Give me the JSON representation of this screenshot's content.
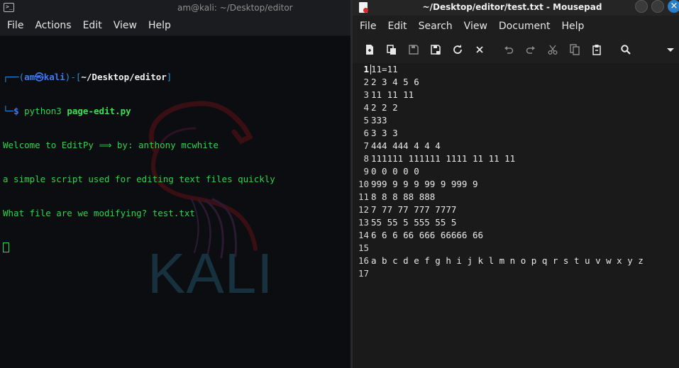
{
  "terminal": {
    "title": "am@kali: ~/Desktop/editor",
    "menu": [
      "File",
      "Actions",
      "Edit",
      "View",
      "Help"
    ],
    "prompt": {
      "open": "┌──(",
      "user": "am",
      "at": "㉿",
      "host": "kali",
      "mid": ")-[",
      "path": "~/Desktop/editor",
      "close": "]",
      "second": "└─",
      "dollar": "$ ",
      "cmd": "python3",
      "arg": " page-edit.py"
    },
    "output": [
      "Welcome to EditPy ⟹ by: anthony mcwhite",
      "a simple script used for editing text files quickly"
    ],
    "question": "What file are we modifying? ",
    "answer": "test.txt",
    "logo_text": "KALI"
  },
  "mousepad": {
    "title": "~/Desktop/editor/test.txt - Mousepad",
    "close_glyph": "×",
    "menu": [
      "File",
      "Edit",
      "Search",
      "View",
      "Document",
      "Help"
    ],
    "toolbar_icons": [
      "new-document-icon",
      "new-window-icon",
      "save-icon",
      "save-as-icon",
      "reload-icon",
      "close-document-icon",
      "undo-icon",
      "redo-icon",
      "cut-icon",
      "copy-icon",
      "paste-icon",
      "search-icon",
      "dropdown-arrow-icon"
    ],
    "lines": [
      {
        "n": "1",
        "text": "11=11"
      },
      {
        "n": "2",
        "text": "2 3 4 5 6"
      },
      {
        "n": "3",
        "text": "11 11 11"
      },
      {
        "n": "4",
        "text": "2 2 2"
      },
      {
        "n": "5",
        "text": "333"
      },
      {
        "n": "6",
        "text": "3 3 3"
      },
      {
        "n": "7",
        "text": "444 444 4 4 4"
      },
      {
        "n": "8",
        "text": "111111 111111 1111 11 11 11"
      },
      {
        "n": "9",
        "text": "0 0 0 0 0"
      },
      {
        "n": "10",
        "text": "999 9 9 9 99 9 999 9"
      },
      {
        "n": "11",
        "text": "8 8 8 88 888"
      },
      {
        "n": "12",
        "text": "7 77 77 777 7777"
      },
      {
        "n": "13",
        "text": "55 55 5 555 55 5"
      },
      {
        "n": "14",
        "text": "6 6 6 66 666 66666 66"
      },
      {
        "n": "15",
        "text": ""
      },
      {
        "n": "16",
        "text": "a b c d e f g h i j k l m n o p q r s t u v w x y z"
      },
      {
        "n": "17",
        "text": ""
      }
    ]
  }
}
